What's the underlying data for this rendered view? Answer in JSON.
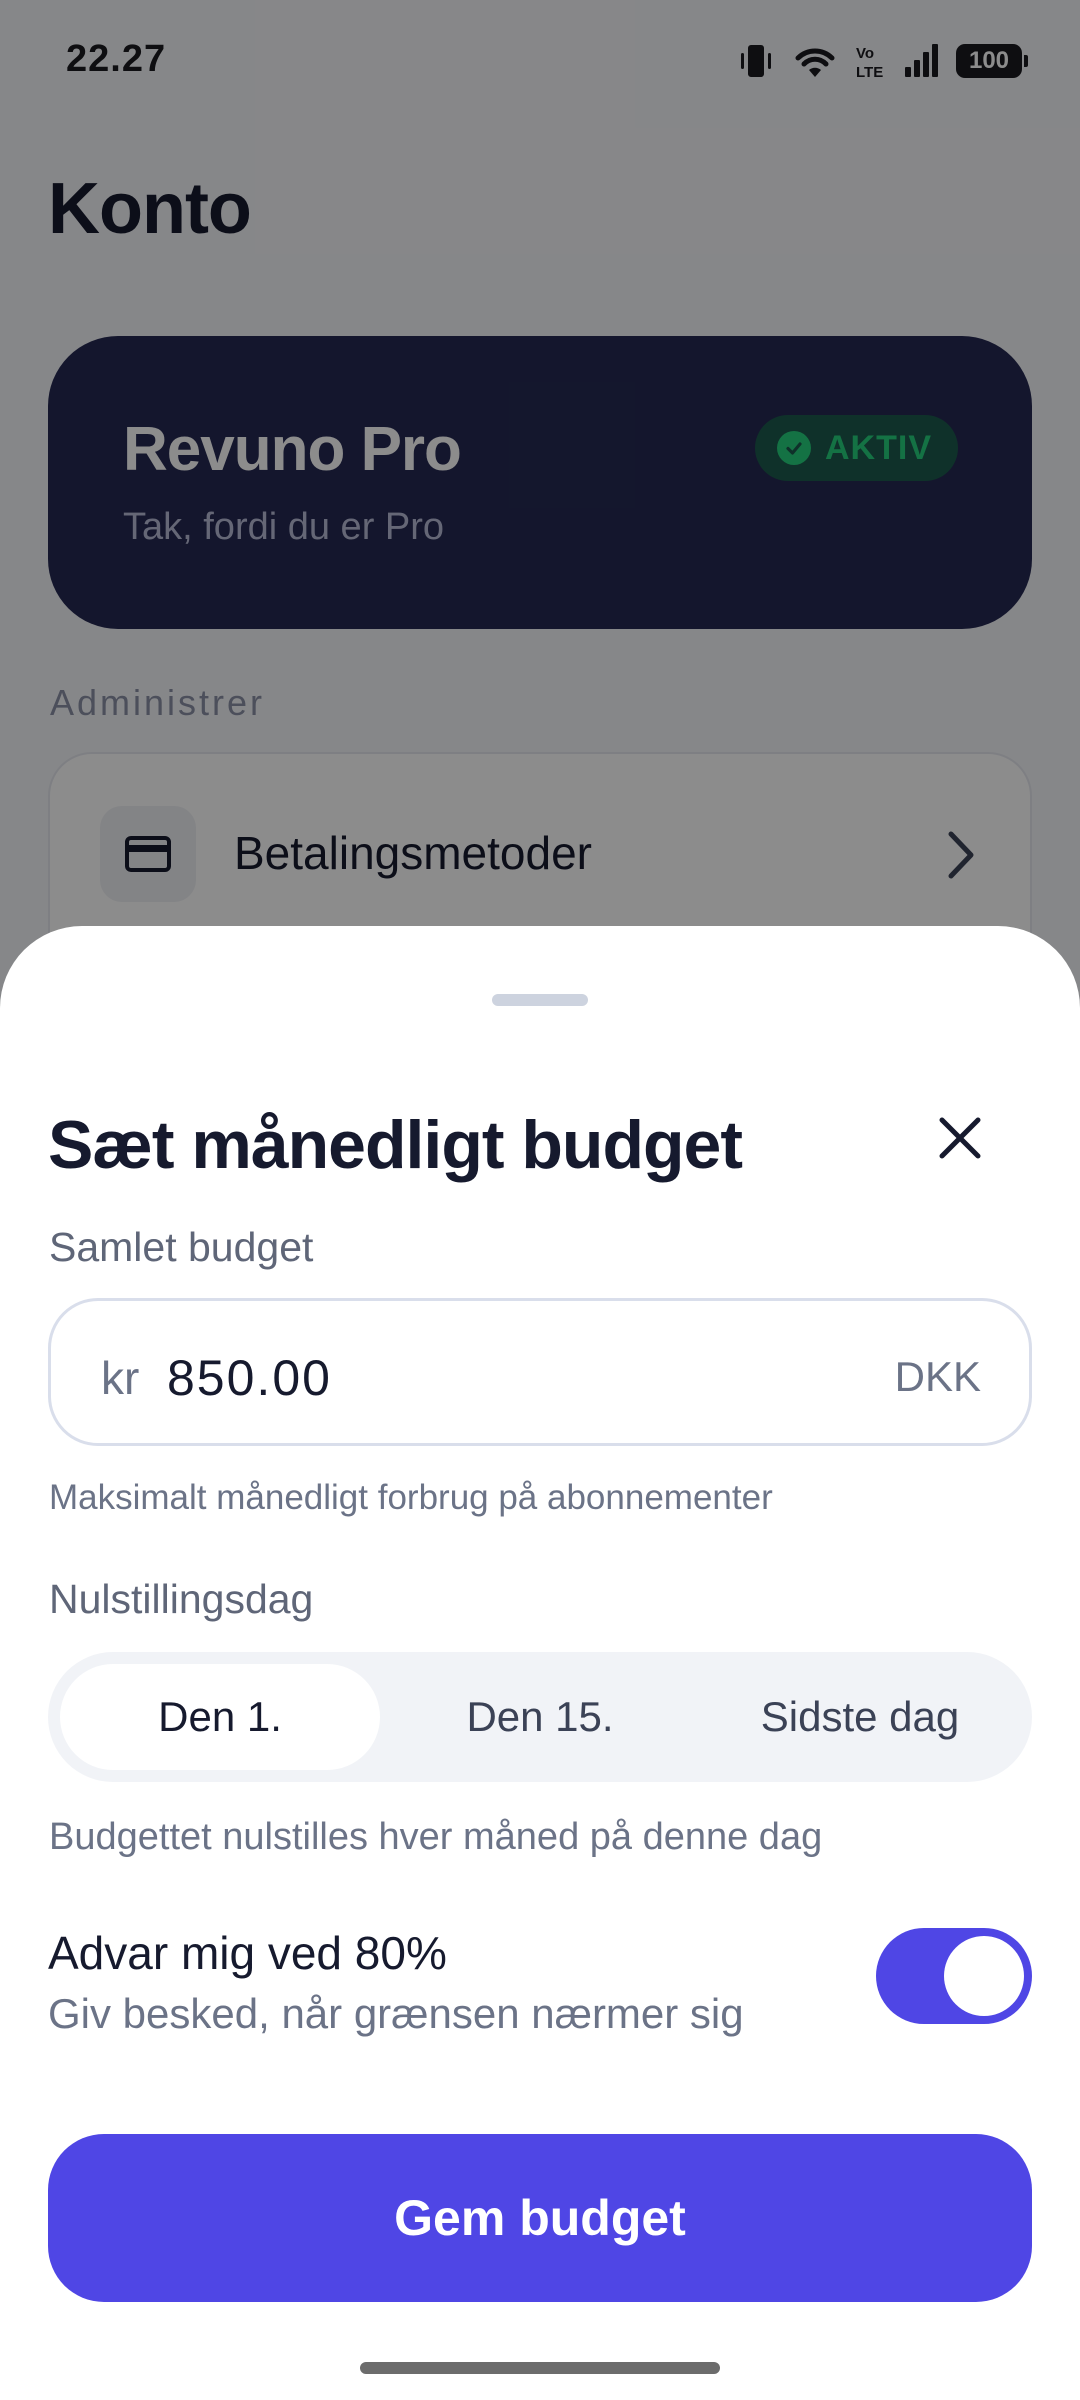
{
  "status_bar": {
    "time": "22.27",
    "battery": "100",
    "icons": [
      "vibrate-icon",
      "wifi-icon",
      "volte-icon",
      "signal-icon",
      "battery-icon"
    ]
  },
  "page": {
    "title": "Konto",
    "pro_card": {
      "title": "Revuno Pro",
      "subtitle": "Tak, fordi du er Pro",
      "badge": "AKTIV",
      "badge_color": "#26d07c"
    },
    "section_label": "Administrer",
    "manage_items": [
      {
        "label": "Betalingsmetoder",
        "icon": "credit-card-icon"
      }
    ]
  },
  "sheet": {
    "title": "Sæt månedligt budget",
    "total_budget": {
      "label": "Samlet budget",
      "prefix": "kr",
      "value": "850.00",
      "currency": "DKK",
      "helper": "Maksimalt månedligt forbrug på abonnementer"
    },
    "reset_day": {
      "label": "Nulstillingsdag",
      "options": [
        "Den 1.",
        "Den 15.",
        "Sidste dag"
      ],
      "selected": "Den 1.",
      "helper": "Budgettet nulstilles hver måned på denne dag"
    },
    "warning": {
      "title": "Advar mig ved 80%",
      "subtitle": "Giv besked, når grænsen nærmer sig",
      "enabled": true
    },
    "save_label": "Gem budget",
    "accent_color": "#4f46e5"
  }
}
